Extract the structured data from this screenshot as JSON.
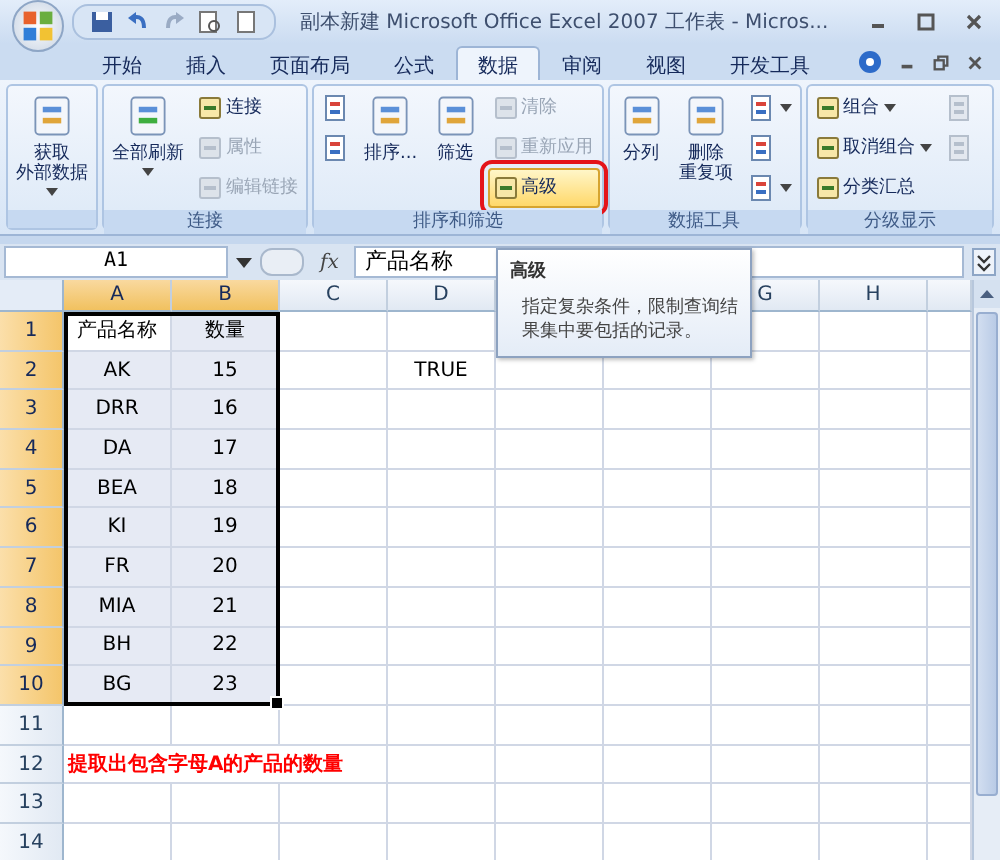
{
  "title_bar": {
    "title": "副本新建 Microsoft Office Excel 2007 工作表 - Micros..."
  },
  "tabs": [
    {
      "label": "开始",
      "selected": false
    },
    {
      "label": "插入",
      "selected": false
    },
    {
      "label": "页面布局",
      "selected": false
    },
    {
      "label": "公式",
      "selected": false
    },
    {
      "label": "数据",
      "selected": true
    },
    {
      "label": "审阅",
      "selected": false
    },
    {
      "label": "视图",
      "selected": false
    },
    {
      "label": "开发工具",
      "selected": false
    }
  ],
  "ribbon": {
    "groups": [
      {
        "columns": [
          [
            {
              "kind": "large",
              "lines": [
                "获取",
                "外部数据"
              ],
              "dropdown": true,
              "disabled": false,
              "highlighted": false
            }
          ]
        ]
      },
      {
        "label": "连接",
        "columns": [
          [
            {
              "kind": "large",
              "lines": [
                "全部刷新"
              ],
              "dropdown": true,
              "disabled": false,
              "highlighted": false
            }
          ],
          [
            {
              "kind": "small",
              "lines": [
                "连接"
              ],
              "dropdown": false,
              "disabled": false,
              "highlighted": false
            },
            {
              "kind": "small",
              "lines": [
                "属性"
              ],
              "dropdown": false,
              "disabled": true,
              "highlighted": false
            },
            {
              "kind": "small",
              "lines": [
                "编辑链接"
              ],
              "dropdown": false,
              "disabled": true,
              "highlighted": false
            }
          ]
        ]
      },
      {
        "label": "排序和筛选",
        "columns": [
          [
            {
              "kind": "icon",
              "dropdown": false,
              "disabled": false,
              "highlighted": false
            },
            {
              "kind": "icon",
              "dropdown": false,
              "disabled": false,
              "highlighted": false
            }
          ],
          [
            {
              "kind": "large",
              "lines": [
                "排序..."
              ],
              "dropdown": false,
              "disabled": false,
              "highlighted": false
            }
          ],
          [
            {
              "kind": "large",
              "lines": [
                "筛选"
              ],
              "dropdown": false,
              "disabled": false,
              "highlighted": false
            }
          ],
          [
            {
              "kind": "small",
              "lines": [
                "清除"
              ],
              "dropdown": false,
              "disabled": true,
              "highlighted": false
            },
            {
              "kind": "small",
              "lines": [
                "重新应用"
              ],
              "dropdown": false,
              "disabled": true,
              "highlighted": false
            },
            {
              "kind": "small",
              "lines": [
                "高级"
              ],
              "dropdown": false,
              "disabled": false,
              "highlighted": true
            }
          ]
        ]
      },
      {
        "label": "数据工具",
        "columns": [
          [
            {
              "kind": "large",
              "lines": [
                "分列"
              ],
              "dropdown": false,
              "disabled": false,
              "highlighted": false
            }
          ],
          [
            {
              "kind": "large",
              "lines": [
                "删除",
                "重复项"
              ],
              "dropdown": false,
              "disabled": false,
              "highlighted": false
            }
          ],
          [
            {
              "kind": "icon",
              "dropdown": true,
              "disabled": false,
              "highlighted": false
            },
            {
              "kind": "icon",
              "dropdown": false,
              "disabled": false,
              "highlighted": false
            },
            {
              "kind": "icon",
              "dropdown": true,
              "disabled": false,
              "highlighted": false
            }
          ]
        ]
      },
      {
        "label": "分级显示",
        "columns": [
          [
            {
              "kind": "small",
              "lines": [
                "组合"
              ],
              "dropdown": true,
              "disabled": false,
              "highlighted": false
            },
            {
              "kind": "small",
              "lines": [
                "取消组合"
              ],
              "dropdown": true,
              "disabled": false,
              "highlighted": false
            },
            {
              "kind": "small",
              "lines": [
                "分类汇总"
              ],
              "dropdown": false,
              "disabled": false,
              "highlighted": false
            }
          ],
          [
            {
              "kind": "icon",
              "dropdown": false,
              "disabled": true,
              "highlighted": false
            },
            {
              "kind": "icon",
              "dropdown": false,
              "disabled": true,
              "highlighted": false
            }
          ]
        ]
      }
    ]
  },
  "formula_bar": {
    "name_box": "A1",
    "function_label": "fx",
    "formula": "产品名称"
  },
  "tooltip": {
    "title": "高级",
    "text": "指定复杂条件，限制查询结果集中要包括的记录。"
  },
  "sheet": {
    "columns": [
      {
        "label": "A",
        "selected": true
      },
      {
        "label": "B",
        "selected": true
      },
      {
        "label": "C",
        "selected": false
      },
      {
        "label": "D",
        "selected": false
      },
      {},
      {},
      {
        "label": "G",
        "selected": false
      },
      {
        "label": "H",
        "selected": false
      }
    ],
    "rows": [
      {
        "number": "1",
        "selected": true,
        "cells": {
          "A": {
            "text": "产品名称",
            "active": true
          },
          "B": {
            "text": "数量"
          }
        }
      },
      {
        "number": "2",
        "selected": true,
        "cells": {
          "A": {
            "text": "AK"
          },
          "B": {
            "text": "15"
          },
          "D": {
            "text": "TRUE"
          }
        }
      },
      {
        "number": "3",
        "selected": true,
        "cells": {
          "A": {
            "text": "DRR"
          },
          "B": {
            "text": "16"
          }
        }
      },
      {
        "number": "4",
        "selected": true,
        "cells": {
          "A": {
            "text": "DA"
          },
          "B": {
            "text": "17"
          }
        }
      },
      {
        "number": "5",
        "selected": true,
        "cells": {
          "A": {
            "text": "BEA"
          },
          "B": {
            "text": "18"
          }
        }
      },
      {
        "number": "6",
        "selected": true,
        "cells": {
          "A": {
            "text": "KI"
          },
          "B": {
            "text": "19"
          }
        }
      },
      {
        "number": "7",
        "selected": true,
        "cells": {
          "A": {
            "text": "FR"
          },
          "B": {
            "text": "20"
          }
        }
      },
      {
        "number": "8",
        "selected": true,
        "cells": {
          "A": {
            "text": "MIA"
          },
          "B": {
            "text": "21"
          }
        }
      },
      {
        "number": "9",
        "selected": true,
        "cells": {
          "A": {
            "text": "BH"
          },
          "B": {
            "text": "22"
          }
        }
      },
      {
        "number": "10",
        "selected": true,
        "cells": {
          "A": {
            "text": "BG"
          },
          "B": {
            "text": "23"
          }
        }
      },
      {
        "number": "11",
        "selected": false,
        "cells": {}
      },
      {
        "number": "12",
        "selected": false,
        "cells": {
          "A": {
            "text": "提取出包含字母A的产品的数量",
            "kind": "note",
            "color": "#ff0000"
          }
        }
      },
      {
        "number": "13",
        "selected": false,
        "cells": {}
      },
      {
        "number": "14",
        "selected": false,
        "cells": {}
      }
    ]
  }
}
